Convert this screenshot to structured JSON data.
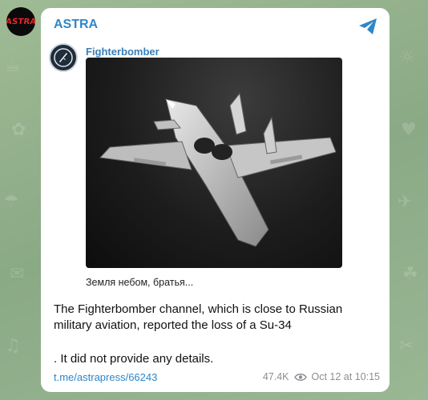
{
  "channel": {
    "name": "ASTRA",
    "avatar_text": "ASTRA"
  },
  "forward": {
    "source_name": "Fighterbomber",
    "photo_caption": "Земля небом, братья..."
  },
  "message": {
    "text_line1": "The Fighterbomber channel, which is close to Russian military aviation, reported the loss of a Su-34",
    "text_line2": ". It did not provide any details.",
    "link": "t.me/astrapress/66243",
    "views": "47.4K",
    "timestamp": "Oct 12 at 10:15"
  },
  "icons": {
    "share": "share-telegram-icon",
    "views": "eye-icon"
  },
  "colors": {
    "accent": "#2f86c8",
    "avatar_bg": "#0a0a0a",
    "avatar_text": "#e8262a"
  }
}
